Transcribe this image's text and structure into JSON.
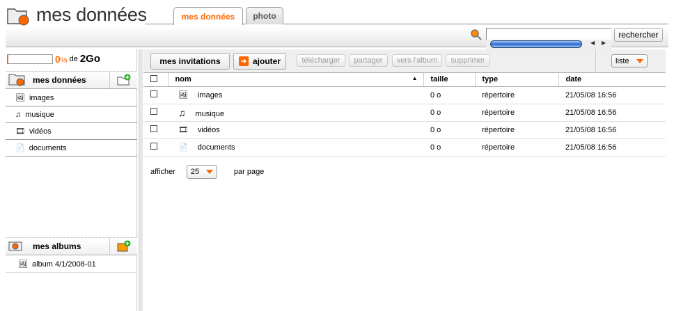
{
  "header": {
    "title": "mes données",
    "tabs": [
      {
        "label": "mes données",
        "active": true
      },
      {
        "label": "photo",
        "active": false
      }
    ]
  },
  "search": {
    "value": "",
    "button": "rechercher"
  },
  "quota": {
    "percent": "0",
    "percent_sign": "%",
    "of": "de",
    "total": "2Go",
    "fill": 0
  },
  "sidebar": {
    "data_title": "mes données",
    "items": [
      {
        "label": "images",
        "icon": "image-icon"
      },
      {
        "label": "musique",
        "icon": "music-icon"
      },
      {
        "label": "vidéos",
        "icon": "film-icon"
      },
      {
        "label": "documents",
        "icon": "document-icon"
      }
    ],
    "albums_title": "mes albums",
    "albums": [
      {
        "label": "album 4/1/2008-01"
      }
    ]
  },
  "toolbar": {
    "invitations": "mes invitations",
    "add": "ajouter",
    "download": "télécharger",
    "share": "partager",
    "to_album": "vers l'album",
    "delete": "supprimer",
    "view": "liste"
  },
  "table": {
    "headers": [
      "nom",
      "taille",
      "type",
      "date"
    ],
    "rows": [
      {
        "name": "images",
        "size": "0 o",
        "type": "répertoire",
        "date": "21/05/08 16:56"
      },
      {
        "name": "musique",
        "size": "0 o",
        "type": "répertoire",
        "date": "21/05/08 16:56"
      },
      {
        "name": "vidéos",
        "size": "0 o",
        "type": "répertoire",
        "date": "21/05/08 16:56"
      },
      {
        "name": "documents",
        "size": "0 o",
        "type": "répertoire",
        "date": "21/05/08 16:56"
      }
    ]
  },
  "paging": {
    "show": "afficher",
    "per_page_value": "25",
    "per_page": "par page"
  }
}
